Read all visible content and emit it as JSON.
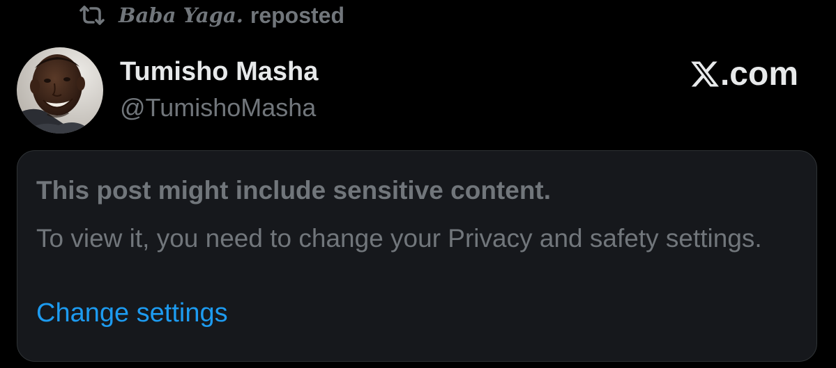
{
  "repost": {
    "icon": "repost-icon",
    "reposter": "Baba Yaga.",
    "label": "reposted"
  },
  "author": {
    "name": "Tumisho Masha",
    "handle": "@TumishoMasha",
    "avatar_icon": "avatar"
  },
  "brand": {
    "icon": "x-logo-icon",
    "text": ".com"
  },
  "notice": {
    "title": "This post might include sensitive content.",
    "body": "To view it, you need to change your Privacy and safety settings.",
    "link": "Change settings"
  },
  "colors": {
    "background": "#000000",
    "card_background": "#16181c",
    "card_border": "#2f3336",
    "primary_text": "#e7e9ea",
    "secondary_text": "#71767b",
    "link": "#1d9bf0"
  }
}
